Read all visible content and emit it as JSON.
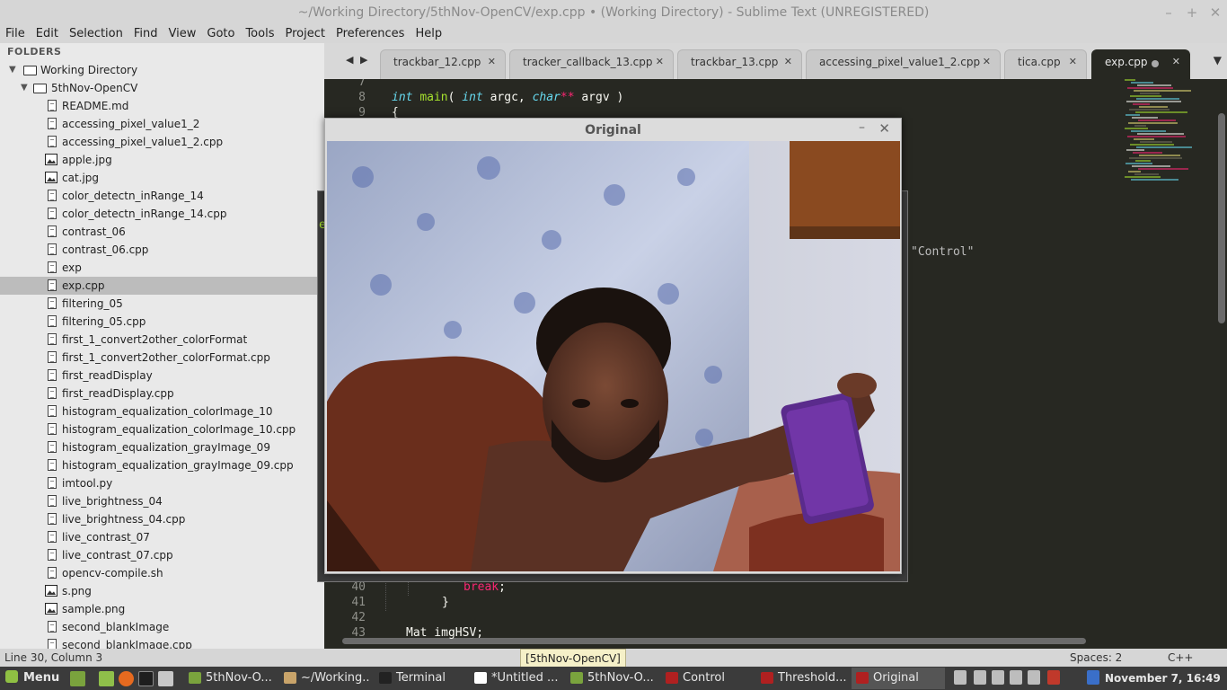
{
  "window": {
    "title": "~/Working Directory/5thNov-OpenCV/exp.cpp • (Working Directory) - Sublime Text (UNREGISTERED)",
    "min_label": "–",
    "max_label": "+",
    "close_label": "✕"
  },
  "menu": [
    "File",
    "Edit",
    "Selection",
    "Find",
    "View",
    "Goto",
    "Tools",
    "Project",
    "Preferences",
    "Help"
  ],
  "sidebar": {
    "header": "FOLDERS",
    "root": "Working Directory",
    "folder": "5thNov-OpenCV",
    "files": [
      {
        "name": "README.md",
        "icon": "file"
      },
      {
        "name": "accessing_pixel_value1_2",
        "icon": "file"
      },
      {
        "name": "accessing_pixel_value1_2.cpp",
        "icon": "file"
      },
      {
        "name": "apple.jpg",
        "icon": "image"
      },
      {
        "name": "cat.jpg",
        "icon": "image"
      },
      {
        "name": "color_detectn_inRange_14",
        "icon": "file"
      },
      {
        "name": "color_detectn_inRange_14.cpp",
        "icon": "file"
      },
      {
        "name": "contrast_06",
        "icon": "file"
      },
      {
        "name": "contrast_06.cpp",
        "icon": "file"
      },
      {
        "name": "exp",
        "icon": "file"
      },
      {
        "name": "exp.cpp",
        "icon": "file",
        "selected": true
      },
      {
        "name": "filtering_05",
        "icon": "file"
      },
      {
        "name": "filtering_05.cpp",
        "icon": "file"
      },
      {
        "name": "first_1_convert2other_colorFormat",
        "icon": "file"
      },
      {
        "name": "first_1_convert2other_colorFormat.cpp",
        "icon": "file"
      },
      {
        "name": "first_readDisplay",
        "icon": "file"
      },
      {
        "name": "first_readDisplay.cpp",
        "icon": "file"
      },
      {
        "name": "histogram_equalization_colorImage_10",
        "icon": "file"
      },
      {
        "name": "histogram_equalization_colorImage_10.cpp",
        "icon": "file"
      },
      {
        "name": "histogram_equalization_grayImage_09",
        "icon": "file"
      },
      {
        "name": "histogram_equalization_grayImage_09.cpp",
        "icon": "file"
      },
      {
        "name": "imtool.py",
        "icon": "file"
      },
      {
        "name": "live_brightness_04",
        "icon": "file"
      },
      {
        "name": "live_brightness_04.cpp",
        "icon": "file"
      },
      {
        "name": "live_contrast_07",
        "icon": "file"
      },
      {
        "name": "live_contrast_07.cpp",
        "icon": "file"
      },
      {
        "name": "opencv-compile.sh",
        "icon": "file"
      },
      {
        "name": "s.png",
        "icon": "image"
      },
      {
        "name": "sample.png",
        "icon": "image"
      },
      {
        "name": "second_blankImage",
        "icon": "file"
      },
      {
        "name": "second_blankImage.cpp",
        "icon": "file"
      }
    ]
  },
  "tabs": [
    {
      "label": "trackbar_12.cpp",
      "close": "✕"
    },
    {
      "label": "tracker_callback_13.cpp",
      "close": "✕"
    },
    {
      "label": "trackbar_13.cpp",
      "close": "✕"
    },
    {
      "label": "accessing_pixel_value1_2.cpp",
      "close": "✕"
    },
    {
      "label": "tica.cpp",
      "close": "✕"
    },
    {
      "label": "exp.cpp",
      "close": "✕",
      "active": true,
      "modified": true
    }
  ],
  "tab_nav": {
    "prev": "◀",
    "next": "▶",
    "dropdown": "▼"
  },
  "editor": {
    "lines_top": [
      {
        "num": "7"
      },
      {
        "num": "8",
        "parts": [
          [
            "kw-type",
            "int"
          ],
          [
            "",
            " "
          ],
          [
            "kw-fn",
            "main"
          ],
          [
            "",
            "( "
          ],
          [
            "kw-type",
            "int"
          ],
          [
            "",
            " argc, "
          ],
          [
            "kw-type",
            "char"
          ],
          [
            "kw-ctl",
            "**"
          ],
          [
            "",
            " argv )"
          ]
        ]
      },
      {
        "num": "9",
        "parts": [
          [
            "",
            "{"
          ]
        ]
      }
    ],
    "lines_bottom": [
      {
        "num": "40",
        "parts": [
          [
            "kw-ctl",
            "break"
          ],
          [
            "",
            ";"
          ]
        ],
        "indent": 80
      },
      {
        "num": "41",
        "parts": [
          [
            "",
            "}"
          ]
        ],
        "indent": 56
      },
      {
        "num": "42"
      },
      {
        "num": "43",
        "parts": [
          [
            "",
            "Mat imgHSV;"
          ]
        ],
        "indent": 16
      }
    ],
    "partial_string": "\"Control\"",
    "bg_stub": "e"
  },
  "popup": {
    "title": "Original",
    "min_label": "–",
    "close_label": "✕"
  },
  "status": {
    "position": "Line 30, Column 3",
    "tooltip": "[5thNov-OpenCV]",
    "spaces": "Spaces: 2",
    "syntax": "C++"
  },
  "taskbar": {
    "menu_label": "Menu",
    "tasks": [
      {
        "label": "5thNov-O...",
        "icon_color": "#7aa33d"
      },
      {
        "label": "~/Working...",
        "icon_color": "#c9a46a"
      },
      {
        "label": "Terminal",
        "icon_color": "#222222"
      },
      {
        "label": "*Untitled ...",
        "icon_color": "#ffffff"
      },
      {
        "label": "5thNov-O...",
        "icon_color": "#7aa33d"
      },
      {
        "label": "Control",
        "icon_color": "#b02020"
      },
      {
        "label": "Threshold...",
        "icon_color": "#b02020"
      },
      {
        "label": "Original",
        "icon_color": "#b02020",
        "active": true
      }
    ],
    "clock": "November 7, 16:49"
  },
  "colors": {
    "editor_bg": "#272822",
    "keyword_type": "#66d9ef",
    "keyword_fn": "#a6e22e",
    "keyword_ctl": "#f92672"
  }
}
